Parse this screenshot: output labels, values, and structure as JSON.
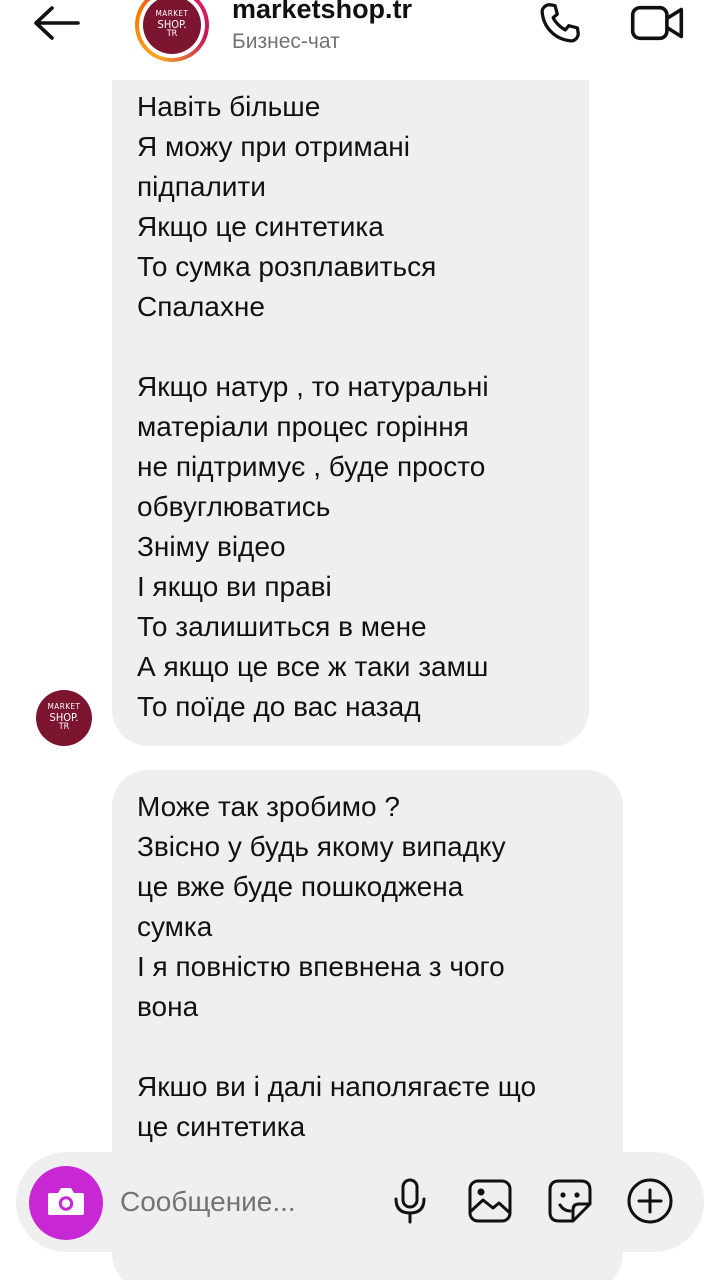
{
  "header": {
    "title": "marketshop.tr",
    "subtitle": "Бизнес-чат",
    "icons": {
      "back": "arrow-left-icon",
      "call": "phone-icon",
      "video": "video-camera-icon"
    }
  },
  "brand_logo": {
    "line1": "MARKET",
    "line2": "SHOP.",
    "line3": "TR",
    "color": "#7b1530"
  },
  "messages": [
    {
      "sender": "marketshop.tr",
      "text": "Навіть більше\nЯ можу при отримані\nпідпалити\nЯкщо це синтетика\nТо сумка розплавиться\nСпалахне\n\nЯкщо натур , то натуральні\nматеріали процес горіння\nне підтримує , буде просто\nобвуглюватись\nЗніму відео\nІ якщо ви праві\nТо залишиться в мене\nА якщо це все ж таки замш\nТо поїде до вас назад"
    },
    {
      "sender": "marketshop.tr",
      "text": "Може так зробимо ?\nЗвісно у будь якому випадку\nце вже буде пошкоджена\nсумка\nІ я повністю впевнена з чого\nвона\n\nЯкшо ви і далі наполягаєте що\nце синтетика"
    }
  ],
  "composer": {
    "placeholder": "Сообщение...",
    "camera_color": "#c728d3",
    "icons": [
      "camera-icon",
      "microphone-icon",
      "gallery-icon",
      "sticker-icon",
      "plus-circle-icon"
    ]
  },
  "colors": {
    "bubble_bg": "#efefef",
    "composer_bg": "#efefef",
    "subtitle_text": "#737373"
  }
}
